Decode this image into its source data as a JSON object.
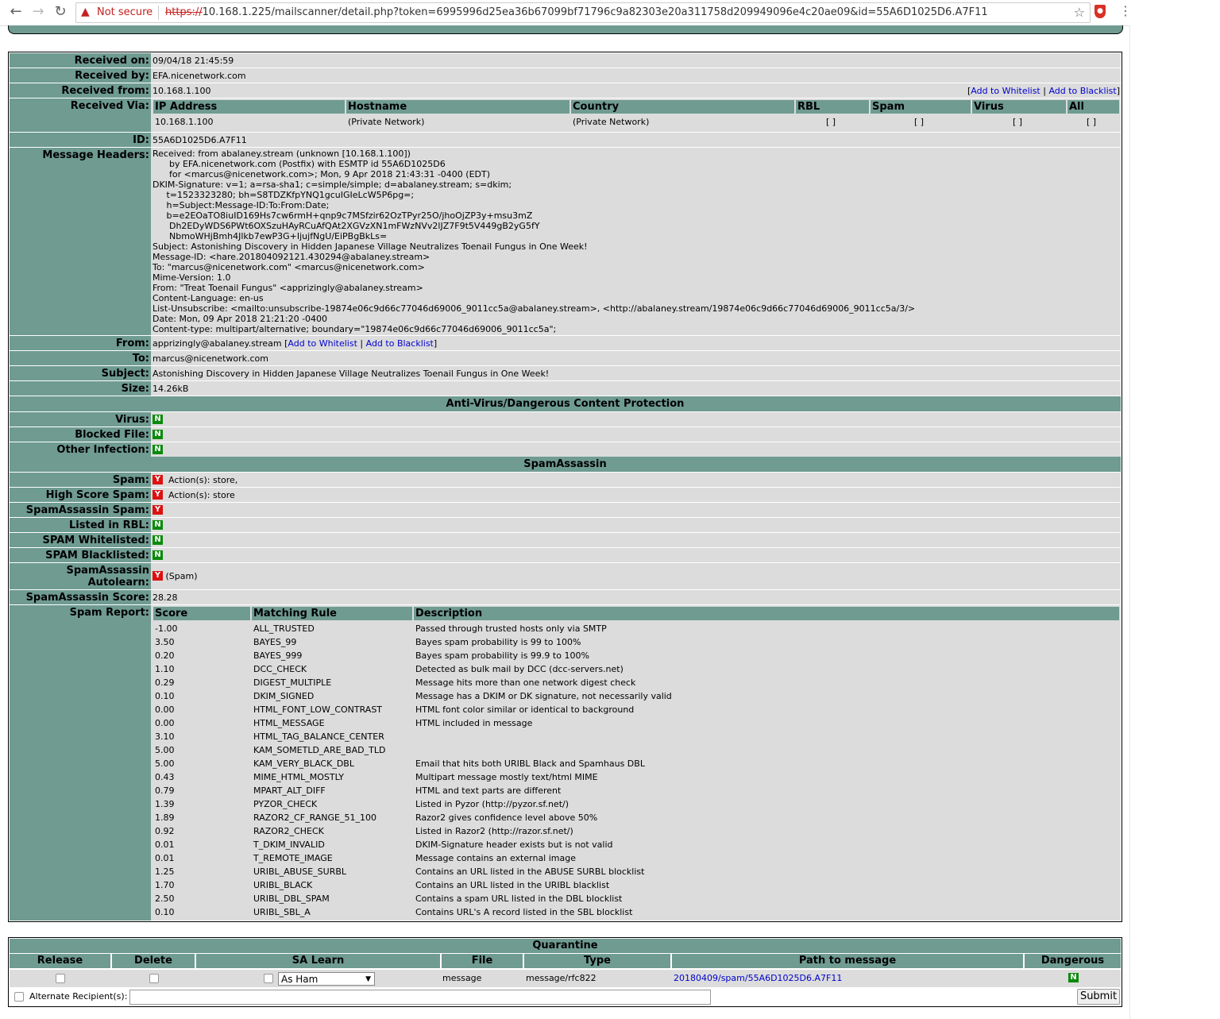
{
  "browser": {
    "not_secure": "Not secure",
    "url_scheme": "https://",
    "url_rest": "10.168.1.225/mailscanner/detail.php?token=6995996d25ea36b67099bf71796c9a82303e20a311758d209949096e4c20ae09&id=55A6D1025D6.A7F11"
  },
  "labels": {
    "received_on": "Received on:",
    "received_by": "Received by:",
    "received_from": "Received from:",
    "received_via": "Received Via:",
    "id": "ID:",
    "message_headers": "Message Headers:",
    "from": "From:",
    "to": "To:",
    "subject": "Subject:",
    "size": "Size:",
    "virus": "Virus:",
    "blocked_file": "Blocked File:",
    "other_infection": "Other Infection:",
    "spam": "Spam:",
    "high_score_spam": "High Score Spam:",
    "sa_spam": "SpamAssassin Spam:",
    "listed_rbl": "Listed in RBL:",
    "spam_whitelisted": "SPAM Whitelisted:",
    "spam_blacklisted": "SPAM Blacklisted:",
    "sa_autolearn": "SpamAssassin Autolearn:",
    "sa_score": "SpamAssassin Score:",
    "spam_report": "Spam Report:"
  },
  "message": {
    "received_on": "09/04/18 21:45:59",
    "received_by": "EFA.nicenetwork.com",
    "received_from": "10.168.1.100",
    "add_whitelist": "Add to Whitelist",
    "add_blacklist": "Add to Blacklist",
    "id": "55A6D1025D6.A7F11",
    "from": "apprizingly@abalaney.stream",
    "to": "marcus@nicenetwork.com",
    "subject": "Astonishing Discovery in Hidden Japanese Village Neutralizes Toenail Fungus in One Week!",
    "size": "14.26kB",
    "headers": "Received: from abalaney.stream (unknown [10.168.1.100])\n      by EFA.nicenetwork.com (Postfix) with ESMTP id 55A6D1025D6\n      for <marcus@nicenetwork.com>; Mon, 9 Apr 2018 21:43:31 -0400 (EDT)\nDKIM-Signature: v=1; a=rsa-sha1; c=simple/simple; d=abalaney.stream; s=dkim;\n     t=1523323280; bh=S8TDZKfpYNQ1gcuIGIeLcW5P6pg=;\n     h=Subject:Message-ID:To:From:Date;\n     b=e2EOaTO8iuID169Hs7cw6rmH+qnp9c7MSfzir62OzTPyr25O/jhoOjZP3y+msu3mZ\n      Dh2EDyWDS6PWt6OXSzuHAyRCuAfQAt2XGVzXN1mFWzNVv2lJZ7F9t5V449gB2yG5fY\n      NbmoWHjBmh4Jlkb7ewP3G+IjujfNgU/EiPBgBkLs=\nSubject: Astonishing Discovery in Hidden Japanese Village Neutralizes Toenail Fungus in One Week!\nMessage-ID: <hare.201804092121.430294@abalaney.stream>\nTo: \"marcus@nicenetwork.com\" <marcus@nicenetwork.com>\nMime-Version: 1.0\nFrom: \"Treat Toenail Fungus\" <apprizingly@abalaney.stream>\nContent-Language: en-us\nList-Unsubscribe: <mailto:unsubscribe-19874e06c9d66c77046d69006_9011cc5a@abalaney.stream>, <http://abalaney.stream/19874e06c9d66c77046d69006_9011cc5a/3/>\nDate: Mon, 09 Apr 2018 21:21:20 -0400\nContent-type: multipart/alternative; boundary=\"19874e06c9d66c77046d69006_9011cc5a\";"
  },
  "via": {
    "headers": [
      "IP Address",
      "Hostname",
      "Country",
      "RBL",
      "Spam",
      "Virus",
      "All"
    ],
    "row": [
      "10.168.1.100",
      "(Private Network)",
      "(Private Network)",
      "[ ]",
      "[ ]",
      "[ ]",
      "[ ]"
    ]
  },
  "sections": {
    "av": "Anti-Virus/Dangerous Content Protection",
    "sa": "SpamAssassin"
  },
  "flags": {
    "virus": "N",
    "blocked_file": "N",
    "other_infection": "N",
    "spam": "Y",
    "spam_action": "Action(s): store,",
    "high_score_spam": "Y",
    "high_score_action": "Action(s): store",
    "sa_spam": "Y",
    "listed_rbl": "N",
    "spam_whitelisted": "N",
    "spam_blacklisted": "N",
    "sa_autolearn": "Y",
    "sa_autolearn_note": "(Spam)",
    "sa_score": "28.28"
  },
  "spam_report": {
    "headers": [
      "Score",
      "Matching Rule",
      "Description"
    ],
    "rows": [
      [
        "-1.00",
        "ALL_TRUSTED",
        "Passed through trusted hosts only via SMTP"
      ],
      [
        "3.50",
        "BAYES_99",
        "Bayes spam probability is 99 to 100%"
      ],
      [
        "0.20",
        "BAYES_999",
        "Bayes spam probability is 99.9 to 100%"
      ],
      [
        "1.10",
        "DCC_CHECK",
        "Detected as bulk mail by DCC (dcc-servers.net)"
      ],
      [
        "0.29",
        "DIGEST_MULTIPLE",
        "Message hits more than one network digest check"
      ],
      [
        "0.10",
        "DKIM_SIGNED",
        "Message has a DKIM or DK signature, not necessarily valid"
      ],
      [
        "0.00",
        "HTML_FONT_LOW_CONTRAST",
        "HTML font color similar or identical to background"
      ],
      [
        "0.00",
        "HTML_MESSAGE",
        "HTML included in message"
      ],
      [
        "3.10",
        "HTML_TAG_BALANCE_CENTER",
        ""
      ],
      [
        "5.00",
        "KAM_SOMETLD_ARE_BAD_TLD",
        ""
      ],
      [
        "5.00",
        "KAM_VERY_BLACK_DBL",
        "Email that hits both URIBL Black and Spamhaus DBL"
      ],
      [
        "0.43",
        "MIME_HTML_MOSTLY",
        "Multipart message mostly text/html MIME"
      ],
      [
        "0.79",
        "MPART_ALT_DIFF",
        "HTML and text parts are different"
      ],
      [
        "1.39",
        "PYZOR_CHECK",
        "Listed in Pyzor (http://pyzor.sf.net/)"
      ],
      [
        "1.89",
        "RAZOR2_CF_RANGE_51_100",
        "Razor2 gives confidence level above 50%"
      ],
      [
        "0.92",
        "RAZOR2_CHECK",
        "Listed in Razor2 (http://razor.sf.net/)"
      ],
      [
        "0.01",
        "T_DKIM_INVALID",
        "DKIM-Signature header exists but is not valid"
      ],
      [
        "0.01",
        "T_REMOTE_IMAGE",
        "Message contains an external image"
      ],
      [
        "1.25",
        "URIBL_ABUSE_SURBL",
        "Contains an URL listed in the ABUSE SURBL blocklist"
      ],
      [
        "1.70",
        "URIBL_BLACK",
        "Contains an URL listed in the URIBL blacklist"
      ],
      [
        "2.50",
        "URIBL_DBL_SPAM",
        "Contains a spam URL listed in the DBL blocklist"
      ],
      [
        "0.10",
        "URIBL_SBL_A",
        "Contains URL's A record listed in the SBL blocklist"
      ]
    ]
  },
  "quarantine": {
    "title": "Quarantine",
    "headers": [
      "Release",
      "Delete",
      "SA Learn",
      "File",
      "Type",
      "Path to message",
      "Dangerous"
    ],
    "sa_learn_value": "As Ham",
    "file": "message",
    "type": "message/rfc822",
    "path": "20180409/spam/55A6D1025D6.A7F11",
    "dangerous": "N",
    "alt_recipient_label": "Alternate Recipient(s):",
    "submit": "Submit"
  }
}
